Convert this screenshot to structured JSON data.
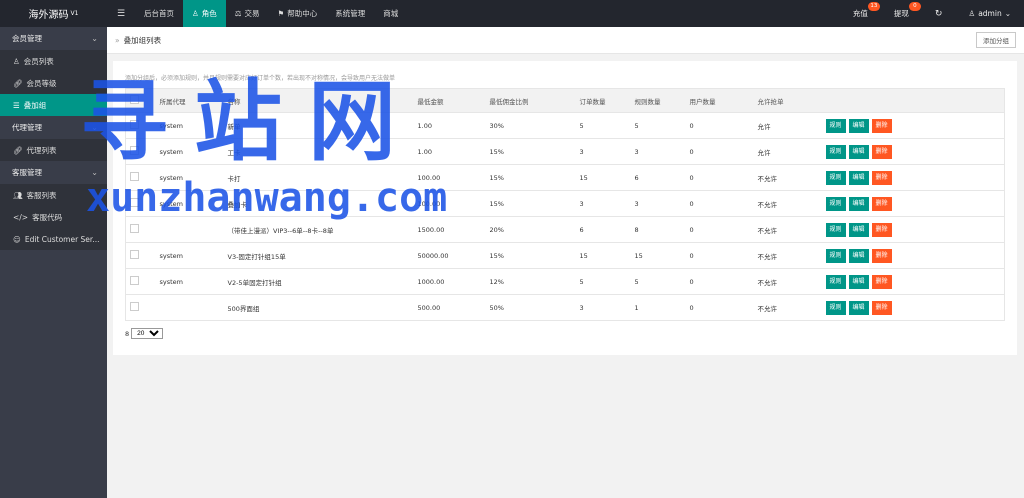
{
  "app": {
    "logo": "海外源码",
    "version": "V1"
  },
  "nav": {
    "toggle_icon": "menu-icon",
    "items": [
      {
        "label": "后台首页",
        "icon": ""
      },
      {
        "label": "角色",
        "icon": "user-icon",
        "active": true
      },
      {
        "label": "交易",
        "icon": "scale-icon"
      },
      {
        "label": "帮助中心",
        "icon": "flag-icon"
      },
      {
        "label": "系统管理",
        "icon": ""
      },
      {
        "label": "商城",
        "icon": ""
      }
    ]
  },
  "topbar_right": {
    "recharge": {
      "label": "充值",
      "badge": "13"
    },
    "withdraw": {
      "label": "提现",
      "badge": "0"
    },
    "refresh_icon": "refresh-icon",
    "user": "admin"
  },
  "sidebar": {
    "groups": [
      {
        "label": "会员管理",
        "items": [
          {
            "label": "会员列表",
            "icon": "user-icon"
          },
          {
            "label": "会员等级",
            "icon": "link-icon"
          },
          {
            "label": "叠加组",
            "icon": "list-icon",
            "active": true
          }
        ]
      },
      {
        "label": "代理管理",
        "items": [
          {
            "label": "代理列表",
            "icon": "link-icon"
          }
        ]
      },
      {
        "label": "客服管理",
        "items": [
          {
            "label": "客服列表",
            "icon": "users-icon"
          },
          {
            "label": "客服代码",
            "icon": "code-icon"
          },
          {
            "label": "Edit Customer Ser...",
            "icon": "face-icon"
          }
        ]
      }
    ]
  },
  "breadcrumb": {
    "title": "叠加组列表"
  },
  "add_button": "添加分组",
  "hint": "添加分组后，必须添加规则，并且规则需要对应好订单个数，若出现不对称情况，会导致用户无法做单",
  "table": {
    "headers": [
      "",
      "所属代理",
      "名称",
      "最低金额",
      "最低佣金比例",
      "订单数量",
      "规则数量",
      "用户数量",
      "允许抢单",
      ""
    ],
    "rows": [
      {
        "agent": "system",
        "name": "新单",
        "min": "1.00",
        "rate": "30%",
        "orders": "5",
        "rules": "5",
        "users": "0",
        "allow": "允许"
      },
      {
        "agent": "system",
        "name": "工卡",
        "min": "1.00",
        "rate": "15%",
        "orders": "3",
        "rules": "3",
        "users": "0",
        "allow": "允许"
      },
      {
        "agent": "system",
        "name": "卡打",
        "min": "100.00",
        "rate": "15%",
        "orders": "15",
        "rules": "6",
        "users": "0",
        "allow": "不允许"
      },
      {
        "agent": "system",
        "name": "叠加卡",
        "min": "100.00",
        "rate": "15%",
        "orders": "3",
        "rules": "3",
        "users": "0",
        "allow": "不允许"
      },
      {
        "agent": "",
        "name": "（带佳上漫派）VIP3--6单--8卡--8单",
        "min": "1500.00",
        "rate": "20%",
        "orders": "6",
        "rules": "8",
        "users": "0",
        "allow": "不允许"
      },
      {
        "agent": "system",
        "name": "V3-固定打针组15单",
        "min": "50000.00",
        "rate": "15%",
        "orders": "15",
        "rules": "15",
        "users": "0",
        "allow": "不允许"
      },
      {
        "agent": "system",
        "name": "V2-5单固定打针组",
        "min": "1000.00",
        "rate": "12%",
        "orders": "5",
        "rules": "5",
        "users": "0",
        "allow": "不允许"
      },
      {
        "agent": "",
        "name": "500界面组",
        "min": "500.00",
        "rate": "50%",
        "orders": "3",
        "rules": "1",
        "users": "0",
        "allow": "不允许"
      }
    ],
    "actions": {
      "rule": "规则",
      "edit": "编辑",
      "delete": "删除"
    }
  },
  "pager": {
    "total": "8",
    "page_size": "20"
  },
  "watermark": {
    "cn": "寻站网",
    "en": "xunzhanwang.com"
  },
  "colors": {
    "accent": "#009688",
    "danger": "#ff5722",
    "topbar": "#23262e",
    "sidebar": "#393d49",
    "watermark": "#1b53e6"
  }
}
